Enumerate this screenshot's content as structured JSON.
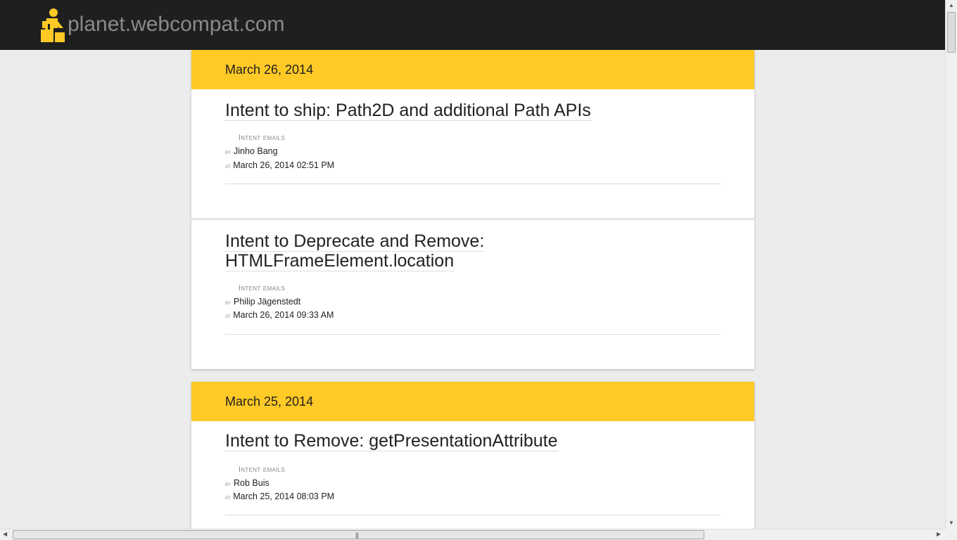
{
  "site": {
    "title": "planet.webcompat.com",
    "logo_icon": "person-pushing-icon",
    "accent": "#ffc926"
  },
  "days": [
    {
      "date": "March 26, 2014",
      "posts": [
        {
          "title": "Intent to ship: Path2D and additional Path APIs",
          "tag": "Intent emails",
          "by_label": "by",
          "author": "Jinho Bang",
          "at_label": "at",
          "datetime": "March 26, 2014 02:51 PM"
        },
        {
          "title": "Intent to Deprecate and Remove: HTMLFrameElement.location",
          "tag": "Intent emails",
          "by_label": "by",
          "author": "Philip Jägenstedt",
          "at_label": "at",
          "datetime": "March 26, 2014 09:33 AM"
        }
      ]
    },
    {
      "date": "March 25, 2014",
      "posts": [
        {
          "title": "Intent to Remove: getPresentationAttribute",
          "tag": "Intent emails",
          "by_label": "by",
          "author": "Rob Buis",
          "at_label": "at",
          "datetime": "March 25, 2014 08:03 PM"
        }
      ]
    }
  ]
}
